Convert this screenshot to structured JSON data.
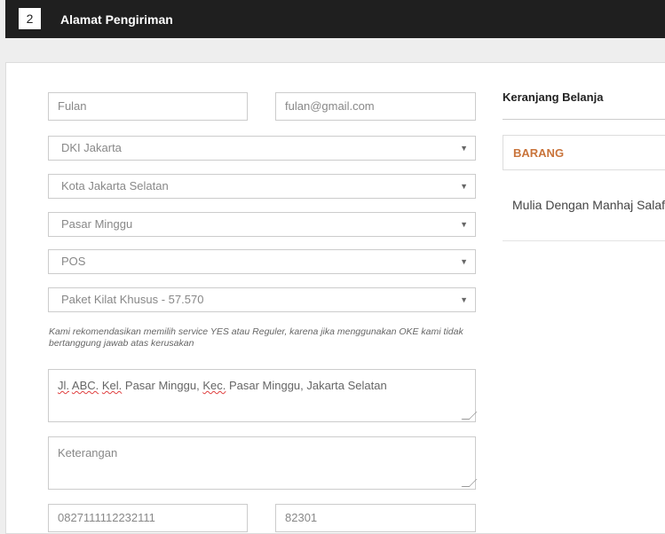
{
  "header": {
    "step_number": "2",
    "title": "Alamat Pengiriman"
  },
  "form": {
    "name_value": "Fulan",
    "email_value": "fulan@gmail.com",
    "province": "DKI Jakarta",
    "city": "Kota Jakarta Selatan",
    "district": "Pasar Minggu",
    "courier": "POS",
    "service": "Paket Kilat Khusus - 57.570",
    "note": "Kami rekomendasikan memilih service YES atau Reguler, karena jika menggunakan OKE kami tidak bertanggung jawab atas kerusakan",
    "address_parts": [
      "Jl.",
      " ",
      "ABC.",
      " ",
      "Kel.",
      " Pasar Minggu, ",
      "Kec.",
      " Pasar Minggu, Jakarta Selatan"
    ],
    "remarks_placeholder": "Keterangan",
    "phone_value": "0827111112232111",
    "postal_value": "82301"
  },
  "cart": {
    "title": "Keranjang Belanja",
    "header": "BARANG",
    "item_name": "Mulia Dengan Manhaj Salaf"
  },
  "colors": {
    "topbar": "#1f1f1f",
    "accent": "#c9743b"
  }
}
